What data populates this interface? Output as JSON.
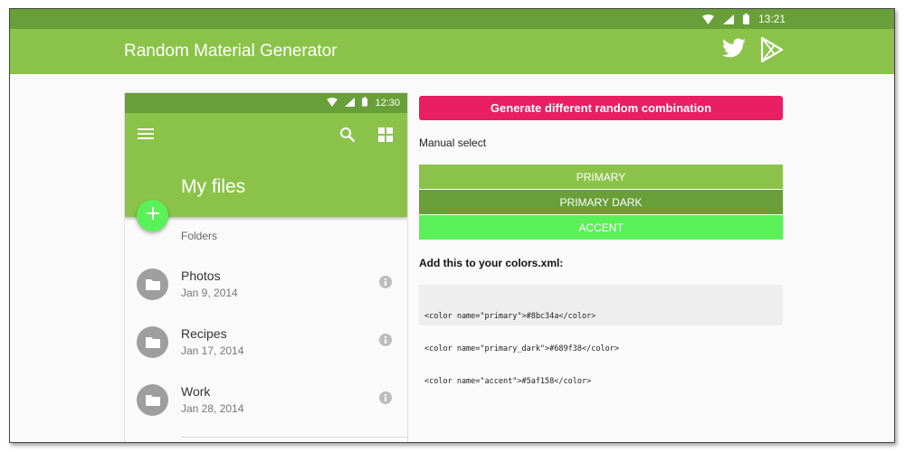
{
  "status_bar": {
    "time": "13:21",
    "icons": [
      "wifi-icon",
      "signal-icon",
      "battery-icon"
    ]
  },
  "app_bar": {
    "title": "Random Material Generator",
    "icons": [
      "twitter-icon",
      "google-play-icon"
    ]
  },
  "phone": {
    "status_time": "12:30",
    "title": "My files",
    "toolbar_icons": [
      "menu-icon",
      "search-icon",
      "grid-view-icon"
    ],
    "fab_icon": "add-icon",
    "section_label": "Folders",
    "items": [
      {
        "name": "Photos",
        "date": "Jan 9, 2014"
      },
      {
        "name": "Recipes",
        "date": "Jan 17, 2014"
      },
      {
        "name": "Work",
        "date": "Jan 28, 2014"
      }
    ]
  },
  "controls": {
    "generate_label": "Generate different random combination",
    "manual_label": "Manual select",
    "swatches": [
      {
        "label": "PRIMARY",
        "color": "#8bc34a"
      },
      {
        "label": "PRIMARY DARK",
        "color": "#689f38"
      },
      {
        "label": "ACCENT",
        "color": "#5af158"
      }
    ],
    "xml_label": "Add this to your colors.xml:",
    "xml_lines": [
      "<color name=\"primary\">#8bc34a</color>",
      "<color name=\"primary_dark\">#689f38</color>",
      "<color name=\"accent\">#5af158</color>"
    ]
  },
  "colors": {
    "primary": "#8bc34a",
    "primary_dark": "#689f38",
    "accent": "#5af158",
    "generate_button": "#e91e63"
  }
}
